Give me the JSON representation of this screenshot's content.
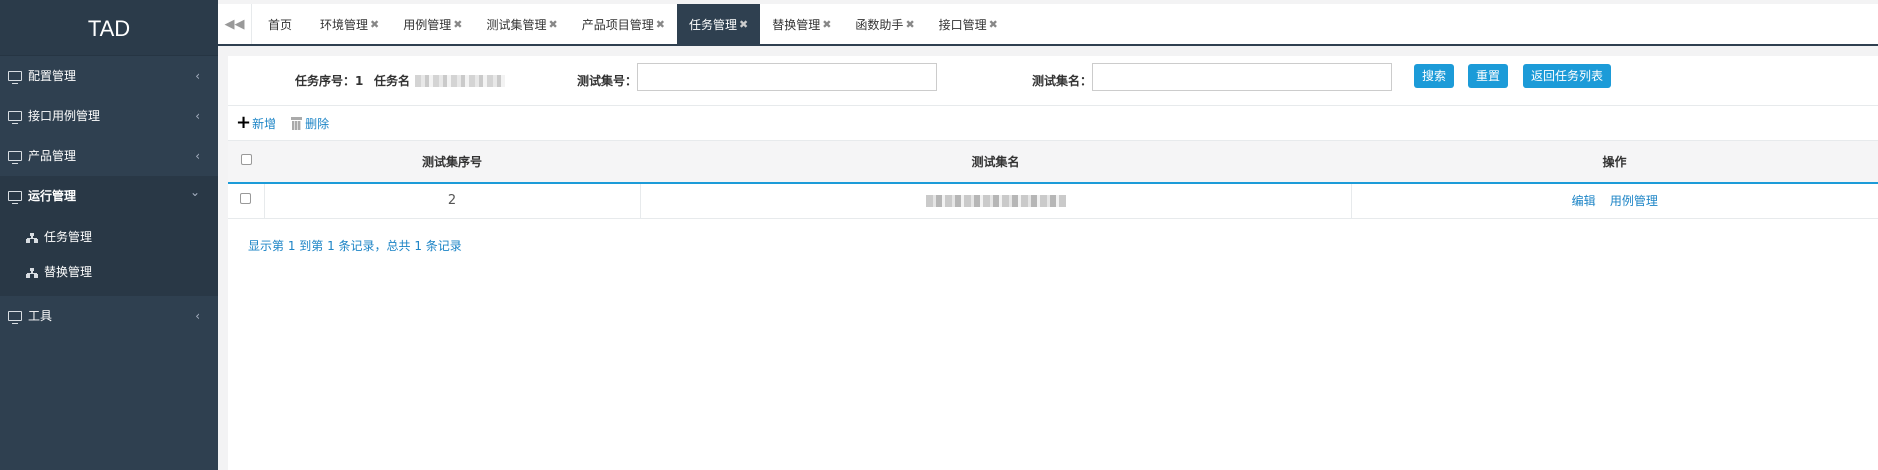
{
  "app": {
    "logo": "TAD"
  },
  "sidebar": {
    "items": [
      {
        "label": "配置管理",
        "arrow": "‹"
      },
      {
        "label": "接口用例管理",
        "arrow": "‹"
      },
      {
        "label": "产品管理",
        "arrow": "‹"
      },
      {
        "label": "运行管理",
        "arrow": "⌄"
      },
      {
        "label": "工具",
        "arrow": "‹"
      }
    ],
    "subitems": [
      {
        "label": "任务管理"
      },
      {
        "label": "替换管理"
      }
    ]
  },
  "tabs": {
    "back_icon": "double-left-arrow",
    "home": "首页",
    "items": [
      {
        "label": "环境管理",
        "close": "✖"
      },
      {
        "label": "用例管理",
        "close": "✖"
      },
      {
        "label": "测试集管理",
        "close": "✖"
      },
      {
        "label": "产品项目管理",
        "close": "✖"
      },
      {
        "label": "任务管理",
        "close": "✖",
        "active": true
      },
      {
        "label": "替换管理",
        "close": "✖"
      },
      {
        "label": "函数助手",
        "close": "✖"
      },
      {
        "label": "接口管理",
        "close": "✖"
      }
    ]
  },
  "search": {
    "task_no_label": "任务序号：1",
    "task_name_label": "任务名",
    "suite_no_label": "测试集号：",
    "suite_no_value": "",
    "suite_name_label": "测试集名：",
    "suite_name_value": "",
    "search_button": "搜索",
    "reset_button": "重置",
    "back_button": "返回任务列表"
  },
  "toolbar": {
    "add_label": "新增",
    "delete_label": "删除"
  },
  "table": {
    "columns": [
      "测试集序号",
      "测试集名",
      "操作"
    ],
    "rows": [
      {
        "index": "2",
        "edit": "编辑",
        "case_manage": "用例管理"
      }
    ]
  },
  "pager": {
    "summary": "显示第 1 到第 1 条记录，总共 1 条记录"
  },
  "colors": {
    "sidebar": "#2f4050",
    "accent": "#1c9bd8",
    "link": "#1c84c6"
  }
}
